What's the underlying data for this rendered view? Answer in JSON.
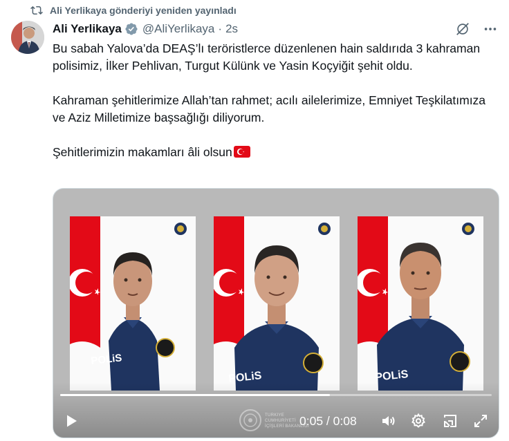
{
  "repost": {
    "icon": "repost-icon",
    "text": "Ali Yerlikaya gönderiyi yeniden yayınladı"
  },
  "tweet": {
    "author_name": "Ali Yerlikaya",
    "verified_icon": "verified-badge-icon",
    "handle": "@AliYerlikaya",
    "separator": "·",
    "time": "2s",
    "actions": [
      "grok-icon",
      "more-icon"
    ],
    "text_paragraphs": [
      "Bu sabah Yalova’da DEAŞ’lı teröristlerce düzenlenen hain saldırıda 3 kahraman polisimiz, İlker Pehlivan, Turgut Külünk ve Yasin Koçyiğit şehit oldu.",
      "Kahraman şehitlerimize Allah’tan rahmet; acılı ailelerimize, Emniyet Teşkilatımıza ve Aziz Milletimize başsağlığı diliyorum.",
      "Şehitlerimizin makamları âli olsun"
    ],
    "emoji": "turkey-flag-emoji"
  },
  "media": {
    "photos": [
      {
        "vest_label": "POLiS"
      },
      {
        "vest_label": "POLiS"
      },
      {
        "vest_label": "POLiS"
      }
    ],
    "watermark_text": "TÜRKİYE CUMHURİYETİ İÇİŞLERİ BAKANLIĞI",
    "video": {
      "current_time": "0:05",
      "duration": "0:08",
      "time_display": "0:05 / 0:08",
      "progress_fraction": 0.625,
      "controls": [
        "play-icon",
        "volume-icon",
        "settings-icon",
        "pip-icon",
        "fullscreen-icon"
      ]
    }
  },
  "colors": {
    "text": "#0f1419",
    "secondary": "#536471",
    "verified": "#829aab",
    "media_bg": "#b9b9b9",
    "flag_red": "#e30a17",
    "uniform": "#1f3460"
  }
}
